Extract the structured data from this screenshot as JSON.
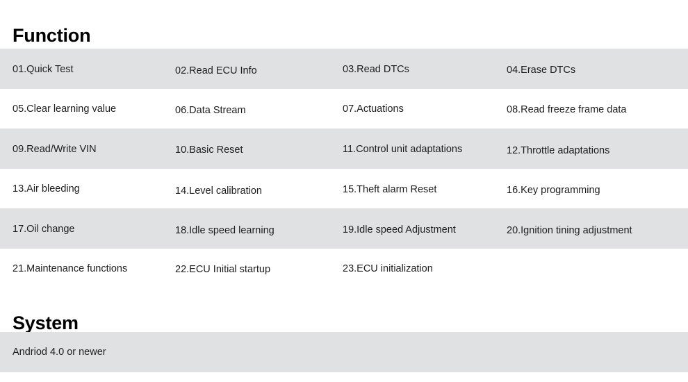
{
  "sections": {
    "function": {
      "heading": "Function",
      "rows": [
        [
          "01.Quick Test",
          "02.Read ECU Info",
          "03.Read DTCs",
          "04.Erase DTCs"
        ],
        [
          "05.Clear learning value",
          "06.Data Stream",
          "07.Actuations",
          "08.Read freeze frame data"
        ],
        [
          "09.Read/Write VIN",
          "10.Basic Reset",
          "11.Control unit adaptations",
          "12.Throttle adaptations"
        ],
        [
          "13.Air bleeding",
          "14.Level calibration",
          "15.Theft alarm Reset",
          "16.Key programming"
        ],
        [
          "17.Oil change",
          "18.Idle speed learning",
          "19.Idle speed Adjustment",
          "20.Ignition tining adjustment"
        ],
        [
          "21.Maintenance functions",
          "22.ECU Initial startup",
          "23.ECU initialization",
          ""
        ]
      ]
    },
    "system": {
      "heading": "System",
      "rows": [
        [
          "Andriod 4.0 or newer"
        ]
      ]
    }
  },
  "colors": {
    "page_background": "#ffffff",
    "row_shaded": "#dfe1e3",
    "text": "#1d1d1d",
    "heading": "#000000"
  }
}
